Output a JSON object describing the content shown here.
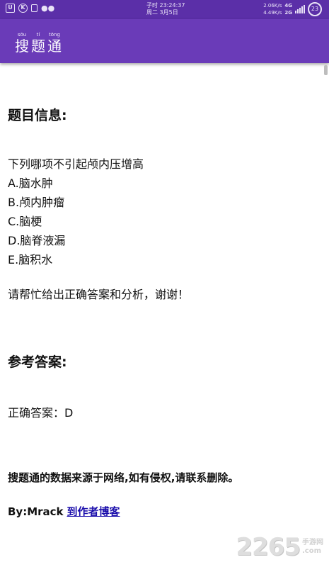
{
  "status_bar": {
    "time": "23:24:37",
    "line1_prefix": "子时",
    "date": "周二 3月5日",
    "speed_up": "2.06K/s",
    "speed_down": "4.49K/s",
    "net_top": "4G",
    "net_bottom": "2G",
    "battery": "23",
    "icons": [
      "u-icon",
      "k-circle-icon",
      "lock-icon",
      "wechat-icon"
    ]
  },
  "app_bar": {
    "title_chars": [
      {
        "pinyin": "sōu",
        "char": "搜"
      },
      {
        "pinyin": "tí",
        "char": "题"
      },
      {
        "pinyin": "tōng",
        "char": "通"
      }
    ]
  },
  "content": {
    "question_heading": "题目信息:",
    "question_stem": "下列哪项不引起颅内压增高",
    "options": [
      "A.脑水肿",
      "B.颅内肿瘤",
      "C.脑梗",
      "D.脑脊液漏",
      "E.脑积水"
    ],
    "request": "请帮忙给出正确答案和分析，谢谢！",
    "answer_heading": "参考答案:",
    "answer": "正确答案：D",
    "disclaimer": "搜题通的数据来源于网络,如有侵权,请联系删除。",
    "byline_prefix": "By:Mrack",
    "author_link": "到作者博客"
  },
  "watermark": {
    "number": "2265",
    "side_top": "手游网",
    "side_bottom": ".com"
  },
  "colors": {
    "status_bar": "#5b2fa8",
    "app_bar": "#6a3bb8",
    "link": "#1a0dab"
  }
}
